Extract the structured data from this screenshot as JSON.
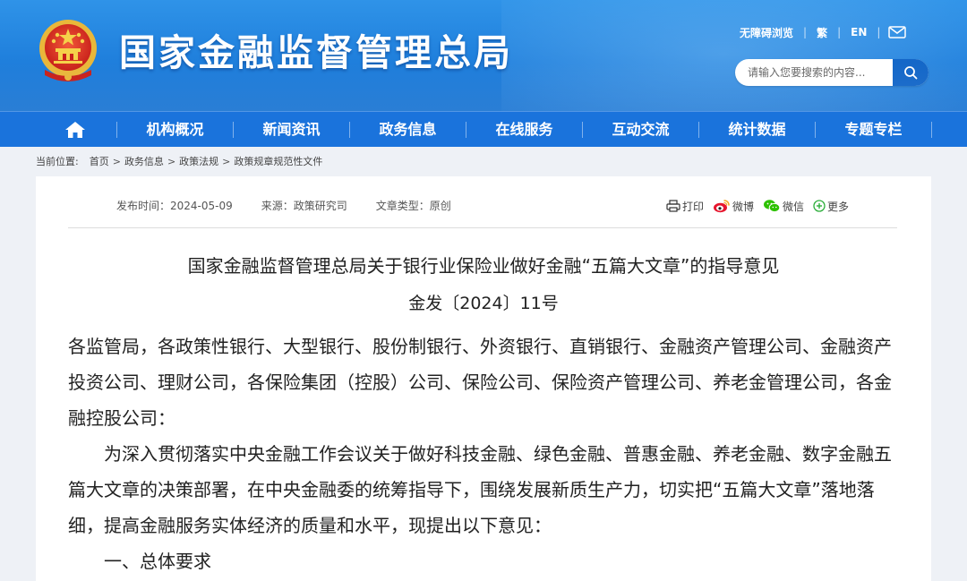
{
  "header": {
    "site_title": "国家金融监督管理总局",
    "top_links": {
      "accessibility": "无障碍浏览",
      "traditional": "繁",
      "english": "EN"
    },
    "search": {
      "placeholder": "请输入您要搜索的内容..."
    }
  },
  "nav": {
    "items": [
      "机构概况",
      "新闻资讯",
      "政务信息",
      "在线服务",
      "互动交流",
      "统计数据",
      "专题专栏"
    ]
  },
  "breadcrumb": {
    "label": "当前位置:",
    "items": [
      "首页",
      "政务信息",
      "政策法规",
      "政策规章规范性文件"
    ]
  },
  "article": {
    "meta": {
      "publish_time": "发布时间：2024-05-09",
      "source": "来源：政策研究司",
      "type": "文章类型：原创"
    },
    "share": {
      "print": "打印",
      "weibo": "微博",
      "wechat": "微信",
      "more": "更多"
    },
    "title": "国家金融监督管理总局关于银行业保险业做好金融“五篇大文章”的指导意见",
    "doc_no": "金发〔2024〕11号",
    "addressees": "各监管局，各政策性银行、大型银行、股份制银行、外资银行、直销银行、金融资产管理公司、金融资产投资公司、理财公司，各保险集团（控股）公司、保险公司、保险资产管理公司、养老金管理公司，各金融控股公司：",
    "paragraph1": "为深入贯彻落实中央金融工作会议关于做好科技金融、绿色金融、普惠金融、养老金融、数字金融五篇大文章的决策部署，在中央金融委的统筹指导下，围绕发展新质生产力，切实把“五篇大文章”落地落细，提高金融服务实体经济的质量和水平，现提出以下意见：",
    "section1": "一、总体要求"
  },
  "colors": {
    "header_blue": "#1f7fdc",
    "nav_blue": "#1a73dc",
    "search_btn": "#1467c8"
  }
}
